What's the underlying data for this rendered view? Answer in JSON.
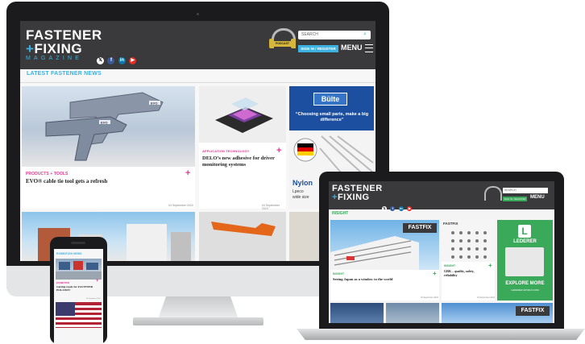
{
  "site": {
    "logo_line1": "FASTENER",
    "logo_plus": "+",
    "logo_line2": "FIXING",
    "logo_line3": "MAGAZINE",
    "podcast_badge": "PODCAST"
  },
  "header": {
    "search_placeholder": "SEARCH",
    "signin_label": "SIGN IN / REGISTER",
    "menu_label": "MENU"
  },
  "desktop": {
    "section_title": "LATEST FASTENER NEWS",
    "cards": [
      {
        "category": "PRODUCTS + TOOLS",
        "headline": "EVO® cable tie tool gets a refresh",
        "date": "04 September 2024"
      },
      {
        "category": "APPLICATION TECHNOLOGY",
        "headline": "DELO’s new adhesive for driver monitoring systems",
        "date": "04 September 2024"
      }
    ],
    "ad_bulte": {
      "brand": "Bülte",
      "tagline": "“Choosing small parts, make a big difference”"
    },
    "ad_nylon": {
      "brand": "Nylon",
      "line2": "Lpeco",
      "line3": "wide size"
    },
    "photo_tool_label": "EVO"
  },
  "laptop": {
    "section_title": "INSIGHT",
    "cards": [
      {
        "category": "INSIGHT",
        "headline": "Seeing Japan as a window to the world",
        "date": "04 September 2024"
      },
      {
        "category": "INSIGHT",
        "headline": "GRK – quality, safety, reliability",
        "date": "04 September 2024"
      }
    ],
    "fastfix_label": "FASTFIX",
    "ad_lederer": {
      "brand": "LEDERER",
      "cta": "EXPLORE MORE",
      "url": "LEDERER-WORLD.COM"
    },
    "fastfix_label_2": "FASTFIX"
  },
  "phone": {
    "section_title": "EXHIBITION NEWS",
    "card": {
      "category": "EXHIBITION",
      "headline": "Getting ready for FASTENER POLAND®",
      "date": "04 September 2024"
    }
  },
  "colors": {
    "accent": "#3db2e0",
    "category": "#e0398f",
    "header": "#3a3a3c",
    "lederer_green": "#3aa95a",
    "laptop_section": "#3aa95a"
  },
  "icons": [
    "x-social-icon",
    "facebook-icon",
    "linkedin-icon",
    "youtube-icon",
    "search-icon",
    "menu-icon",
    "headphones-icon"
  ]
}
